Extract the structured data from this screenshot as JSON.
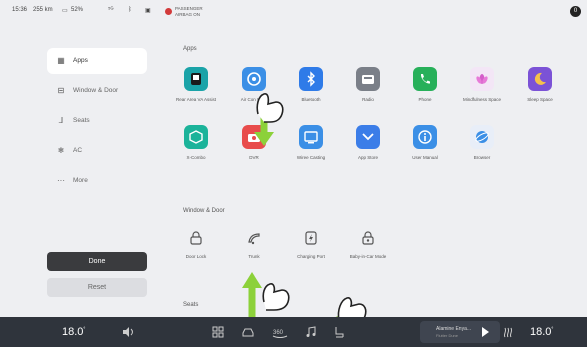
{
  "status": {
    "time": "15:36",
    "range": "255 km",
    "battery": "52%",
    "airbag_line1": "PASSENGER",
    "airbag_line2": "AIRBAG ON",
    "profile_label": "0"
  },
  "sidebar": {
    "items": [
      {
        "label": "Apps",
        "icon": "apps-icon"
      },
      {
        "label": "Window & Door",
        "icon": "car-icon"
      },
      {
        "label": "Seats",
        "icon": "seat-icon"
      },
      {
        "label": "AC",
        "icon": "ac-icon"
      },
      {
        "label": "More",
        "icon": "more-icon"
      }
    ],
    "done_label": "Done",
    "reset_label": "Reset"
  },
  "sections": {
    "apps_title": "Apps",
    "window_title": "Window & Door",
    "seats_title": "Seats"
  },
  "apps": [
    {
      "label": "Rear Area VA Assist",
      "color": "#1aa3a8",
      "icon": "rear-screen-icon"
    },
    {
      "label": "Air Con Wind",
      "color": "#3b8fe6",
      "icon": "fan-icon"
    },
    {
      "label": "Bluetooth",
      "color": "#2f7be8",
      "icon": "bluetooth-icon"
    },
    {
      "label": "Radio",
      "color": "#7a7f88",
      "icon": "radio-icon"
    },
    {
      "label": "Phone",
      "color": "#27b05a",
      "icon": "phone-icon"
    },
    {
      "label": "Mindfulness Space",
      "color": "#f3e6f6",
      "icon": "lotus-icon"
    },
    {
      "label": "Sleep Space",
      "color": "#7b52d6",
      "icon": "moon-icon"
    },
    {
      "label": "X-Combo",
      "color": "#1bb39a",
      "icon": "cube-icon"
    },
    {
      "label": "DVR",
      "color": "#e84c4c",
      "icon": "camera-icon"
    },
    {
      "label": "Wiree Casting",
      "color": "#3b8fe6",
      "icon": "cast-icon"
    },
    {
      "label": "App Store",
      "color": "#3b7de8",
      "icon": "store-icon"
    },
    {
      "label": "User Manual",
      "color": "#3b8fe6",
      "icon": "manual-icon"
    },
    {
      "label": "Browser",
      "color": "#e8eef8",
      "icon": "browser-icon"
    }
  ],
  "window_door": [
    {
      "label": "Door Lock",
      "icon": "lock-icon"
    },
    {
      "label": "Trunk",
      "icon": "trunk-icon"
    },
    {
      "label": "Charging Port",
      "icon": "charging-port-icon"
    },
    {
      "label": "Baby-in-Car Mode",
      "icon": "baby-lock-icon"
    }
  ],
  "dock": {
    "left_temp": "18.0",
    "right_temp": "18.0",
    "degree": "°",
    "music_title": "Alamine Enya...",
    "music_sub": "Flutter Dune",
    "icons": [
      "volume-icon",
      "grid-icon",
      "car-icon",
      "360-view-icon",
      "music-icon",
      "seat-icon"
    ]
  },
  "colors": {
    "dock_bg": "#2f343c",
    "gesture_arrow": "#8cd13a",
    "done_bg": "#3a3b3e",
    "page_bg": "#eeeff2"
  }
}
